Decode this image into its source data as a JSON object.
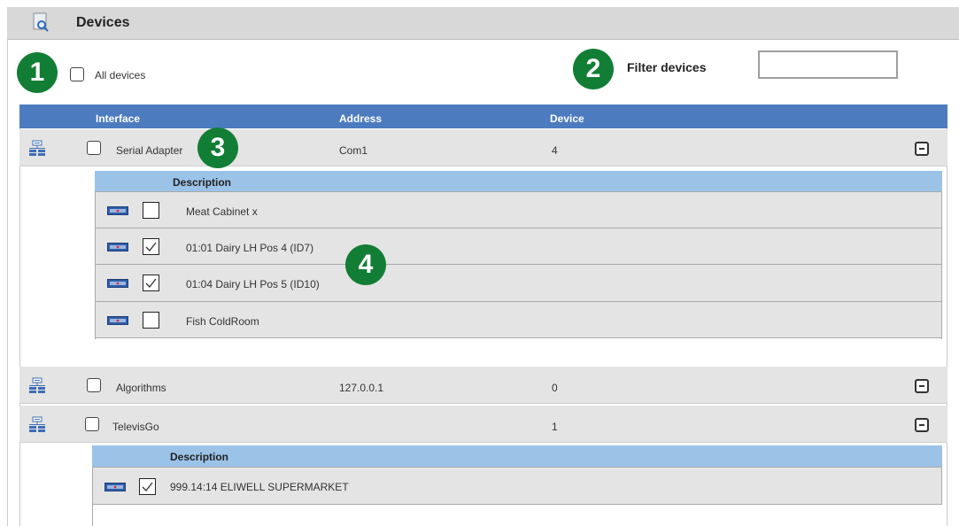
{
  "window": {
    "title": "Devices",
    "icon": "search-document-icon"
  },
  "all_devices": {
    "label": "All devices",
    "checked": false
  },
  "filter": {
    "label": "Filter devices",
    "value": ""
  },
  "callouts": [
    "1",
    "2",
    "3",
    "4"
  ],
  "table": {
    "columns": [
      "Interface",
      "Address",
      "Device"
    ],
    "interfaces": [
      {
        "name": "Serial Adapter",
        "address": "Com1",
        "device": "4",
        "checked": false,
        "expanded": true,
        "description_header": "Description",
        "devices": [
          {
            "description": "Meat Cabinet x",
            "checked": false
          },
          {
            "description": "01:01 Dairy LH Pos 4 (ID7)",
            "checked": true
          },
          {
            "description": "01:04 Dairy LH Pos 5 (ID10)",
            "checked": true
          },
          {
            "description": "Fish ColdRoom",
            "checked": false
          }
        ]
      },
      {
        "name": "Algorithms",
        "address": "127.0.0.1",
        "device": "0",
        "checked": false,
        "expanded": true
      },
      {
        "name": "TelevisGo",
        "address": "",
        "device": "1",
        "checked": false,
        "expanded": true,
        "description_header": "Description",
        "devices": [
          {
            "description": "999.14:14  ELIWELL SUPERMARKET",
            "checked": true
          }
        ]
      }
    ]
  },
  "colors": {
    "header_blue": "#4d7bbf",
    "description_blue": "#9bc3e8",
    "row_gray": "#e4e4e4",
    "callout_green": "#127e35"
  }
}
